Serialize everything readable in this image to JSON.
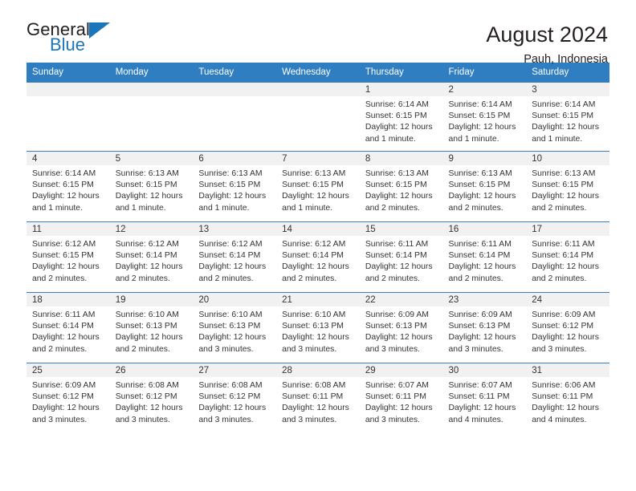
{
  "logo": {
    "word1": "General",
    "word2": "Blue",
    "triangle_color": "#1b75bb",
    "icon": "triangle-icon"
  },
  "header": {
    "title": "August 2024",
    "subtitle": "Pauh, Indonesia"
  },
  "colors": {
    "header_bg": "#2f7ec1",
    "daynum_bg": "#f1f1f1",
    "row_border": "#3d7ebf",
    "text": "#333333"
  },
  "weekdays": [
    "Sunday",
    "Monday",
    "Tuesday",
    "Wednesday",
    "Thursday",
    "Friday",
    "Saturday"
  ],
  "weeks": [
    [
      {
        "empty": true
      },
      {
        "empty": true
      },
      {
        "empty": true
      },
      {
        "empty": true
      },
      {
        "day": "1",
        "sunrise": "Sunrise: 6:14 AM",
        "sunset": "Sunset: 6:15 PM",
        "daylight1": "Daylight: 12 hours",
        "daylight2": "and 1 minute."
      },
      {
        "day": "2",
        "sunrise": "Sunrise: 6:14 AM",
        "sunset": "Sunset: 6:15 PM",
        "daylight1": "Daylight: 12 hours",
        "daylight2": "and 1 minute."
      },
      {
        "day": "3",
        "sunrise": "Sunrise: 6:14 AM",
        "sunset": "Sunset: 6:15 PM",
        "daylight1": "Daylight: 12 hours",
        "daylight2": "and 1 minute."
      }
    ],
    [
      {
        "day": "4",
        "sunrise": "Sunrise: 6:14 AM",
        "sunset": "Sunset: 6:15 PM",
        "daylight1": "Daylight: 12 hours",
        "daylight2": "and 1 minute."
      },
      {
        "day": "5",
        "sunrise": "Sunrise: 6:13 AM",
        "sunset": "Sunset: 6:15 PM",
        "daylight1": "Daylight: 12 hours",
        "daylight2": "and 1 minute."
      },
      {
        "day": "6",
        "sunrise": "Sunrise: 6:13 AM",
        "sunset": "Sunset: 6:15 PM",
        "daylight1": "Daylight: 12 hours",
        "daylight2": "and 1 minute."
      },
      {
        "day": "7",
        "sunrise": "Sunrise: 6:13 AM",
        "sunset": "Sunset: 6:15 PM",
        "daylight1": "Daylight: 12 hours",
        "daylight2": "and 1 minute."
      },
      {
        "day": "8",
        "sunrise": "Sunrise: 6:13 AM",
        "sunset": "Sunset: 6:15 PM",
        "daylight1": "Daylight: 12 hours",
        "daylight2": "and 2 minutes."
      },
      {
        "day": "9",
        "sunrise": "Sunrise: 6:13 AM",
        "sunset": "Sunset: 6:15 PM",
        "daylight1": "Daylight: 12 hours",
        "daylight2": "and 2 minutes."
      },
      {
        "day": "10",
        "sunrise": "Sunrise: 6:13 AM",
        "sunset": "Sunset: 6:15 PM",
        "daylight1": "Daylight: 12 hours",
        "daylight2": "and 2 minutes."
      }
    ],
    [
      {
        "day": "11",
        "sunrise": "Sunrise: 6:12 AM",
        "sunset": "Sunset: 6:15 PM",
        "daylight1": "Daylight: 12 hours",
        "daylight2": "and 2 minutes."
      },
      {
        "day": "12",
        "sunrise": "Sunrise: 6:12 AM",
        "sunset": "Sunset: 6:14 PM",
        "daylight1": "Daylight: 12 hours",
        "daylight2": "and 2 minutes."
      },
      {
        "day": "13",
        "sunrise": "Sunrise: 6:12 AM",
        "sunset": "Sunset: 6:14 PM",
        "daylight1": "Daylight: 12 hours",
        "daylight2": "and 2 minutes."
      },
      {
        "day": "14",
        "sunrise": "Sunrise: 6:12 AM",
        "sunset": "Sunset: 6:14 PM",
        "daylight1": "Daylight: 12 hours",
        "daylight2": "and 2 minutes."
      },
      {
        "day": "15",
        "sunrise": "Sunrise: 6:11 AM",
        "sunset": "Sunset: 6:14 PM",
        "daylight1": "Daylight: 12 hours",
        "daylight2": "and 2 minutes."
      },
      {
        "day": "16",
        "sunrise": "Sunrise: 6:11 AM",
        "sunset": "Sunset: 6:14 PM",
        "daylight1": "Daylight: 12 hours",
        "daylight2": "and 2 minutes."
      },
      {
        "day": "17",
        "sunrise": "Sunrise: 6:11 AM",
        "sunset": "Sunset: 6:14 PM",
        "daylight1": "Daylight: 12 hours",
        "daylight2": "and 2 minutes."
      }
    ],
    [
      {
        "day": "18",
        "sunrise": "Sunrise: 6:11 AM",
        "sunset": "Sunset: 6:14 PM",
        "daylight1": "Daylight: 12 hours",
        "daylight2": "and 2 minutes."
      },
      {
        "day": "19",
        "sunrise": "Sunrise: 6:10 AM",
        "sunset": "Sunset: 6:13 PM",
        "daylight1": "Daylight: 12 hours",
        "daylight2": "and 2 minutes."
      },
      {
        "day": "20",
        "sunrise": "Sunrise: 6:10 AM",
        "sunset": "Sunset: 6:13 PM",
        "daylight1": "Daylight: 12 hours",
        "daylight2": "and 3 minutes."
      },
      {
        "day": "21",
        "sunrise": "Sunrise: 6:10 AM",
        "sunset": "Sunset: 6:13 PM",
        "daylight1": "Daylight: 12 hours",
        "daylight2": "and 3 minutes."
      },
      {
        "day": "22",
        "sunrise": "Sunrise: 6:09 AM",
        "sunset": "Sunset: 6:13 PM",
        "daylight1": "Daylight: 12 hours",
        "daylight2": "and 3 minutes."
      },
      {
        "day": "23",
        "sunrise": "Sunrise: 6:09 AM",
        "sunset": "Sunset: 6:13 PM",
        "daylight1": "Daylight: 12 hours",
        "daylight2": "and 3 minutes."
      },
      {
        "day": "24",
        "sunrise": "Sunrise: 6:09 AM",
        "sunset": "Sunset: 6:12 PM",
        "daylight1": "Daylight: 12 hours",
        "daylight2": "and 3 minutes."
      }
    ],
    [
      {
        "day": "25",
        "sunrise": "Sunrise: 6:09 AM",
        "sunset": "Sunset: 6:12 PM",
        "daylight1": "Daylight: 12 hours",
        "daylight2": "and 3 minutes."
      },
      {
        "day": "26",
        "sunrise": "Sunrise: 6:08 AM",
        "sunset": "Sunset: 6:12 PM",
        "daylight1": "Daylight: 12 hours",
        "daylight2": "and 3 minutes."
      },
      {
        "day": "27",
        "sunrise": "Sunrise: 6:08 AM",
        "sunset": "Sunset: 6:12 PM",
        "daylight1": "Daylight: 12 hours",
        "daylight2": "and 3 minutes."
      },
      {
        "day": "28",
        "sunrise": "Sunrise: 6:08 AM",
        "sunset": "Sunset: 6:11 PM",
        "daylight1": "Daylight: 12 hours",
        "daylight2": "and 3 minutes."
      },
      {
        "day": "29",
        "sunrise": "Sunrise: 6:07 AM",
        "sunset": "Sunset: 6:11 PM",
        "daylight1": "Daylight: 12 hours",
        "daylight2": "and 3 minutes."
      },
      {
        "day": "30",
        "sunrise": "Sunrise: 6:07 AM",
        "sunset": "Sunset: 6:11 PM",
        "daylight1": "Daylight: 12 hours",
        "daylight2": "and 4 minutes."
      },
      {
        "day": "31",
        "sunrise": "Sunrise: 6:06 AM",
        "sunset": "Sunset: 6:11 PM",
        "daylight1": "Daylight: 12 hours",
        "daylight2": "and 4 minutes."
      }
    ]
  ]
}
